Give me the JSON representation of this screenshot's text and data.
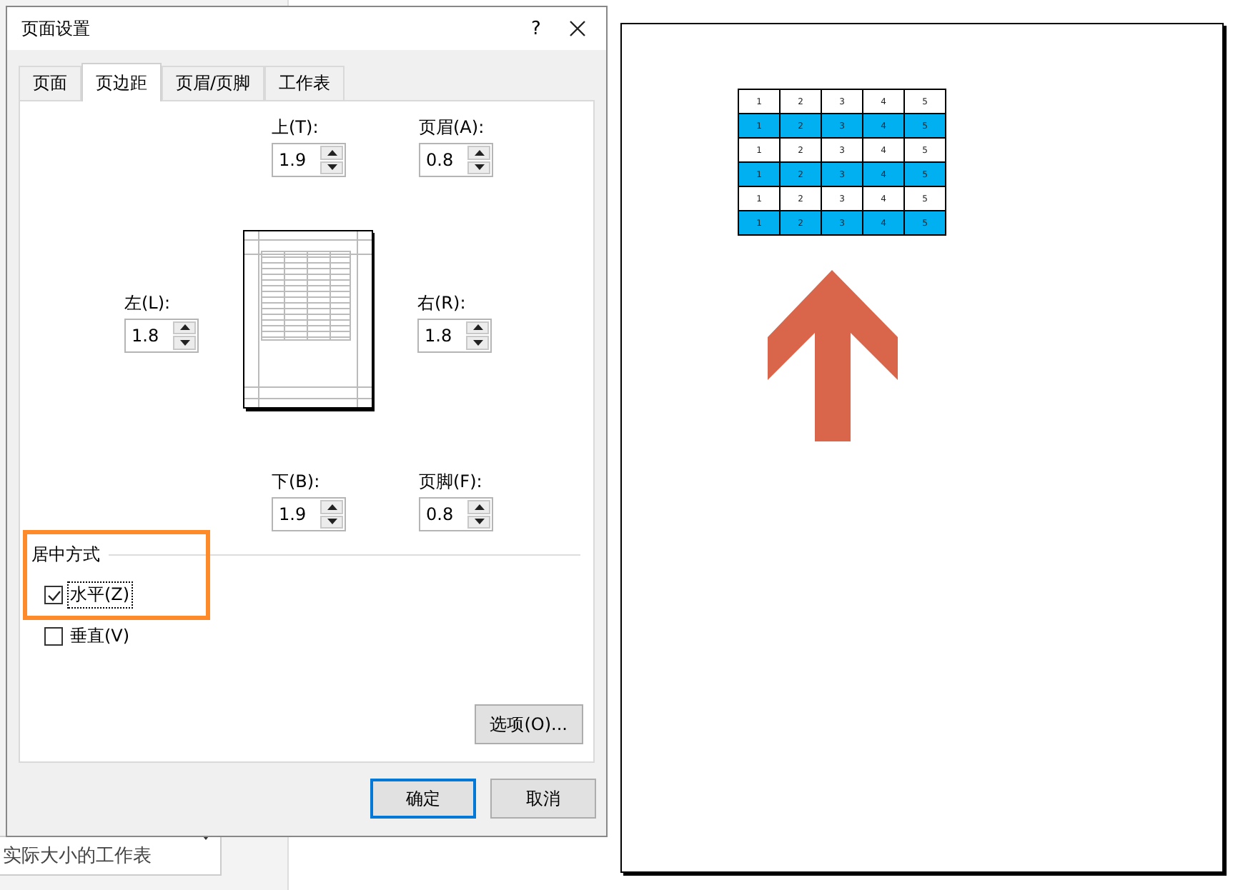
{
  "window": {
    "title": "页面设置",
    "help": "?"
  },
  "tabs": [
    {
      "label": "页面",
      "selected": false
    },
    {
      "label": "页边距",
      "selected": true
    },
    {
      "label": "页眉/页脚",
      "selected": false
    },
    {
      "label": "工作表",
      "selected": false
    }
  ],
  "margins": [
    {
      "kind": "top",
      "label": "上(T):",
      "value": "1.9"
    },
    {
      "kind": "header",
      "label": "页眉(A):",
      "value": "0.8"
    },
    {
      "kind": "left",
      "label": "左(L):",
      "value": "1.8"
    },
    {
      "kind": "right",
      "label": "右(R):",
      "value": "1.8"
    },
    {
      "kind": "bottom",
      "label": "下(B):",
      "value": "1.9"
    },
    {
      "kind": "footer",
      "label": "页脚(F):",
      "value": "0.8"
    }
  ],
  "center": {
    "title": "居中方式",
    "options": [
      {
        "label": "水平(Z)",
        "checked": true,
        "focused": true
      },
      {
        "label": "垂直(V)",
        "checked": false,
        "focused": false
      }
    ]
  },
  "options_button": "选项(O)...",
  "dialog_buttons": [
    {
      "label": "确定",
      "default": true
    },
    {
      "label": "取消",
      "default": false
    }
  ],
  "annotations": {
    "highlight_box": true,
    "arrow": true
  },
  "background": {
    "dropdown_value": "实际大小的工作表"
  },
  "preview_table": [
    {
      "cells": [
        "1",
        "2",
        "3",
        "4",
        "5"
      ],
      "highlighted": false
    },
    {
      "cells": [
        "1",
        "2",
        "3",
        "4",
        "5"
      ],
      "highlighted": true
    },
    {
      "cells": [
        "1",
        "2",
        "3",
        "4",
        "5"
      ],
      "highlighted": false
    },
    {
      "cells": [
        "1",
        "2",
        "3",
        "4",
        "5"
      ],
      "highlighted": true
    },
    {
      "cells": [
        "1",
        "2",
        "3",
        "4",
        "5"
      ],
      "highlighted": false
    },
    {
      "cells": [
        "1",
        "2",
        "3",
        "4",
        "5"
      ],
      "highlighted": true
    }
  ]
}
